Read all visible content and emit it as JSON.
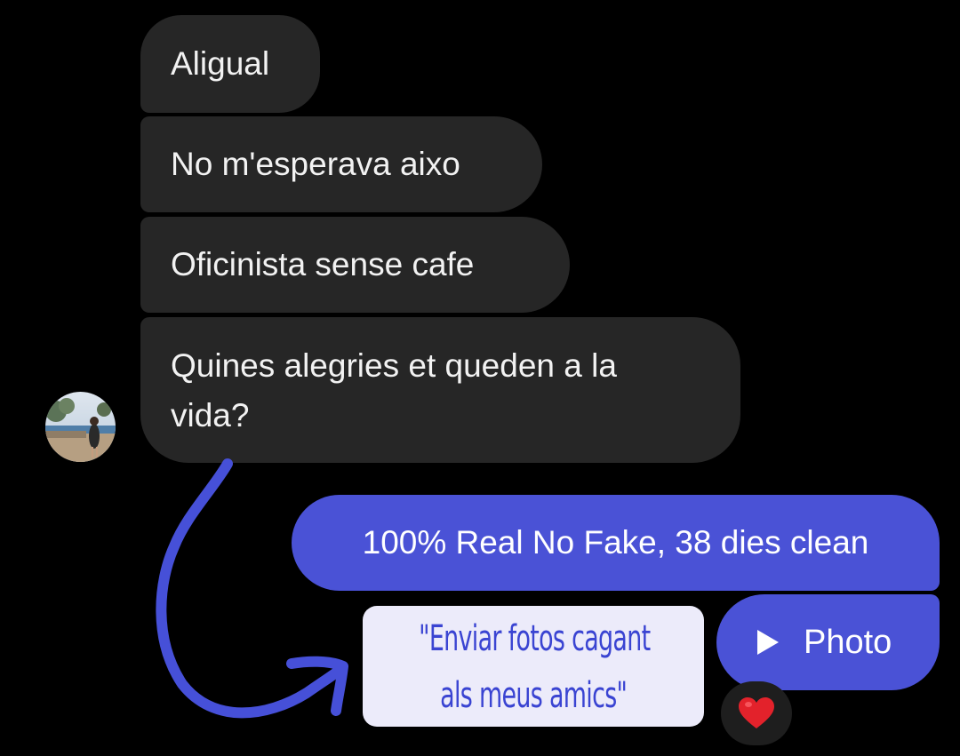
{
  "chat": {
    "incoming": [
      {
        "lines": [
          "Aligual"
        ]
      },
      {
        "lines": [
          "No m'esperava aixo"
        ]
      },
      {
        "lines": [
          "Oficinista sense cafe"
        ]
      },
      {
        "lines": [
          "Quines alegries et queden a la",
          "vida?"
        ]
      }
    ],
    "outgoing": {
      "text": "100% Real No Fake, 38 dies clean",
      "photo_label": "Photo"
    },
    "reaction_icon": "red-heart-icon"
  },
  "annotation": {
    "lines": [
      "\"Enviar fotos cagant",
      "als meus amics\""
    ],
    "color": "#3a44d2",
    "background": "#ecebfa"
  },
  "colors": {
    "incoming_bubble": "#262626",
    "outgoing_bubble": "#4a52d6",
    "background": "#000000"
  }
}
